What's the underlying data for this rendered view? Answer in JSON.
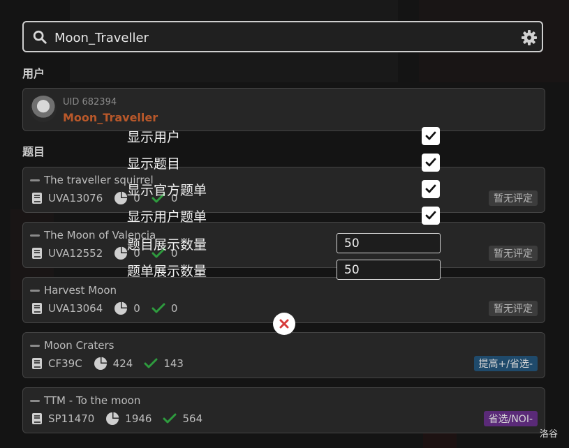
{
  "search": {
    "value": "Moon_Traveller",
    "placeholder": ""
  },
  "sections": {
    "users": "用户",
    "problems": "题目"
  },
  "user": {
    "uid": "UID 682394",
    "name": "Moon_Traveller"
  },
  "problems": [
    {
      "title": "The traveller squirrel",
      "id": "UVA13076",
      "submitted": "0",
      "accepted": "0",
      "tag": "暂无评定",
      "tag_color": "#3c3c3c"
    },
    {
      "title": "The Moon of Valencia",
      "id": "UVA12552",
      "submitted": "0",
      "accepted": "0",
      "tag": "暂无评定",
      "tag_color": "#3c3c3c"
    },
    {
      "title": "Harvest Moon",
      "id": "UVA13064",
      "submitted": "0",
      "accepted": "0",
      "tag": "暂无评定",
      "tag_color": "#3c3c3c"
    },
    {
      "title": "Moon Craters",
      "id": "CF39C",
      "submitted": "424",
      "accepted": "143",
      "tag": "提高+/省选-",
      "tag_color": "#1f4a6b"
    },
    {
      "title": "TTM - To the moon",
      "id": "SP11470",
      "submitted": "1946",
      "accepted": "564",
      "tag": "省选/NOI-",
      "tag_color": "#5a2a78"
    }
  ],
  "settings": {
    "show_users": {
      "label": "显示用户",
      "checked": true
    },
    "show_problems": {
      "label": "显示题目",
      "checked": true
    },
    "show_official_lists": {
      "label": "显示官方题单",
      "checked": true
    },
    "show_user_lists": {
      "label": "显示用户题单",
      "checked": true
    },
    "problem_count": {
      "label": "题目展示数量",
      "value": "50"
    },
    "list_count": {
      "label": "题单展示数量",
      "value": "50"
    }
  },
  "site_label": "洛谷",
  "colors": {
    "accent_orange": "#b9582a",
    "check_green": "#2e9b3e",
    "close_red": "#d63a3a"
  },
  "icons": {
    "search": "search-icon",
    "settings": "gear-icon",
    "close": "close-icon",
    "checkbox": "checkmark-icon"
  }
}
